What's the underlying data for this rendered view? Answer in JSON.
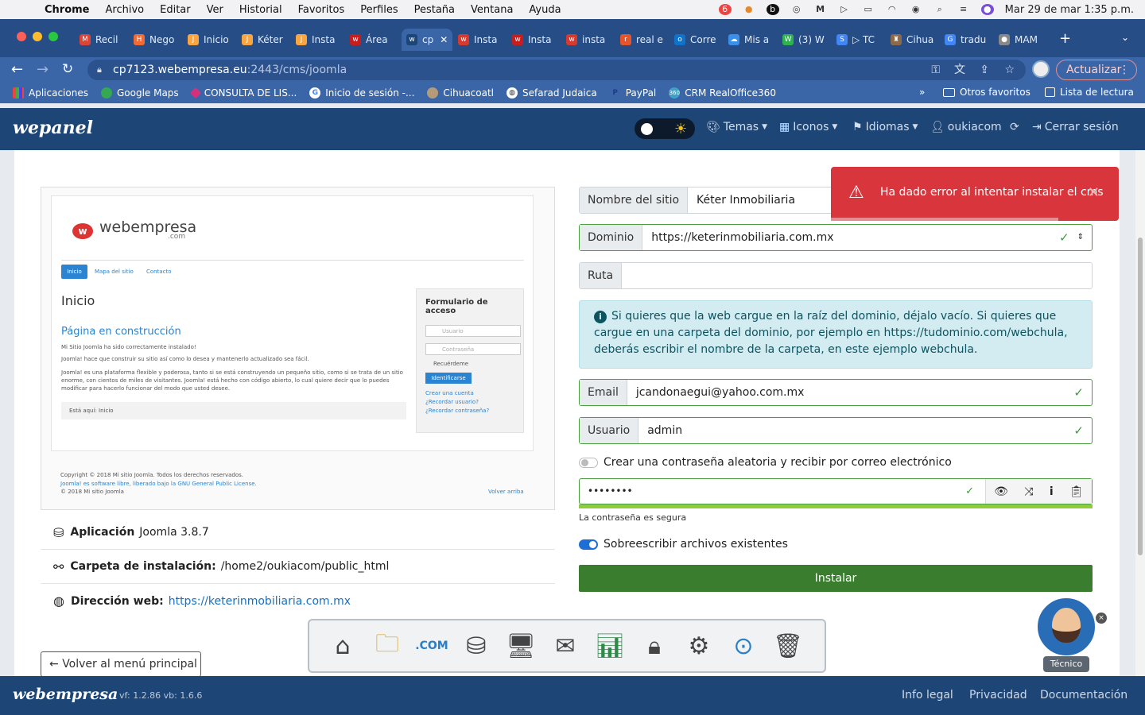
{
  "menubar": {
    "items": [
      "Chrome",
      "Archivo",
      "Editar",
      "Ver",
      "Historial",
      "Favoritos",
      "Perfiles",
      "Pestaña",
      "Ventana",
      "Ayuda"
    ],
    "date_time": "Mar 29 de mar  1:35 p.m.",
    "badge": "6"
  },
  "tabs": [
    {
      "label": "Recil",
      "icon": "M",
      "color": "#db4437"
    },
    {
      "label": "Nego",
      "icon": "H",
      "color": "#f06a35"
    },
    {
      "label": "Inicio",
      "icon": "J",
      "color": "#f9a541"
    },
    {
      "label": "Kéter",
      "icon": "J",
      "color": "#f9a541"
    },
    {
      "label": "Insta",
      "icon": "J",
      "color": "#f9a541"
    },
    {
      "label": "Área",
      "icon": "w",
      "color": "#c81d1d"
    },
    {
      "label": "cp",
      "icon": "w",
      "color": "#1d4677"
    },
    {
      "label": "Insta",
      "icon": "w",
      "color": "#d43a2f"
    },
    {
      "label": "Insta",
      "icon": "w",
      "color": "#c81d1d"
    },
    {
      "label": "insta",
      "icon": "w",
      "color": "#d43a2f"
    },
    {
      "label": "real e",
      "icon": "r",
      "color": "#e5542b"
    },
    {
      "label": "Corre",
      "icon": "o",
      "color": "#0f73c9"
    },
    {
      "label": "Mis a",
      "icon": "☁",
      "color": "#3b8fe8"
    },
    {
      "label": "(3) W",
      "icon": "W",
      "color": "#2fb24f"
    },
    {
      "label": "▷ TC",
      "icon": "S",
      "color": "#4285f4"
    },
    {
      "label": "Cihua",
      "icon": "♜",
      "color": "#8a6a4a"
    },
    {
      "label": "tradu",
      "icon": "G",
      "color": "#4285f4"
    },
    {
      "label": "MAM",
      "icon": "●",
      "color": "#888"
    }
  ],
  "address": {
    "host": "cp7123.webempresa.eu",
    "path": ":2443/cms/joomla",
    "update_label": "Actualizar"
  },
  "bookmarks": [
    "Aplicaciones",
    "Google Maps",
    "CONSULTA DE LIS...",
    "Inicio de sesión -...",
    "Cihuacoatl",
    "Sefarad Judaica",
    "PayPal",
    "CRM RealOffice360"
  ],
  "bookmarks_right": [
    "Otros favoritos",
    "Lista de lectura"
  ],
  "header": {
    "logo": "wepanel",
    "nav": [
      "Temas",
      "Iconos",
      "Idiomas",
      "oukiacom",
      "Cerrar sesión"
    ]
  },
  "preview": {
    "brand": "webempresa",
    "brand_suffix": ".com",
    "nav": [
      "Inicio",
      "Mapa del sitio",
      "Contacto"
    ],
    "heading": "Inicio",
    "subheading": "Página en construcción",
    "line1": "Mi Sitio Joomla ha sido correctamente instalado!",
    "line2": "Joomla! hace que construir su sitio así como lo desea y mantenerlo actualizado sea fácil.",
    "line3": "Joomla! es una plataforma flexible y poderosa, tanto si se está construyendo un pequeño sitio, como si se trata de un sitio enorme, con cientos de miles de visitantes. Joomla! está hecho con código abierto, lo cual quiere decir que lo puedes modificar para hacerlo funcionar del modo que usted desee.",
    "breadcrumb": "Está aquí:   Inicio",
    "login_title": "Formulario de acceso",
    "user_ph": "Usuario",
    "pass_ph": "Contraseña",
    "remember": "Recuérdeme",
    "login_btn": "Identificarse",
    "link1": "Crear una cuenta",
    "link2": "¿Recordar usuario?",
    "link3": "¿Recordar contraseña?",
    "footer1": "Copyright © 2018 Mi sitio Joomla. Todos los derechos reservados.",
    "footer2": "Joomla! es software libre, liberado bajo la GNU General Public License.",
    "footer3": "© 2018 Mi sitio Joomla",
    "back_top": "Volver arriba"
  },
  "info": {
    "app_label": "Aplicación",
    "app_value": "Joomla 3.8.7",
    "folder_label": "Carpeta de instalación:",
    "folder_value": "/home2/oukiacom/public_html",
    "url_label": "Dirección web:",
    "url_value": "https://keterinmobiliaria.com.mx"
  },
  "form": {
    "site_name_label": "Nombre del sitio",
    "site_name_value": "Kéter Inmobiliaria",
    "domain_label": "Dominio",
    "domain_value": "https://keterinmobiliaria.com.mx",
    "path_label": "Ruta",
    "path_value": "",
    "info_text": "Si quieres que la web cargue en la raíz del dominio, déjalo vacío. Si quieres que cargue en una carpeta del dominio, por ejemplo en https://tudominio.com/webchula, deberás escribir el nombre de la carpeta, en este ejemplo webchula.",
    "email_label": "Email",
    "email_value": "jcandonaegui@yahoo.com.mx",
    "user_label": "Usuario",
    "user_value": "admin",
    "random_pwd_label": "Crear una contraseña aleatoria y recibir por correo electrónico",
    "password_mask": "••••••••",
    "password_strength": "La contraseña es segura",
    "overwrite_label": "Sobreescribir archivos existentes",
    "install_label": "Instalar",
    "back_label": "Volver al menú principal"
  },
  "toast": {
    "message": "Ha dado error al intentar instalar el cms"
  },
  "assistant": {
    "label": "Técnico"
  },
  "footer": {
    "logo": "webempresa",
    "version": "vf: 1.2.86 vb: 1.6.6",
    "links": [
      "Info legal",
      "Privacidad",
      "Documentación"
    ]
  }
}
